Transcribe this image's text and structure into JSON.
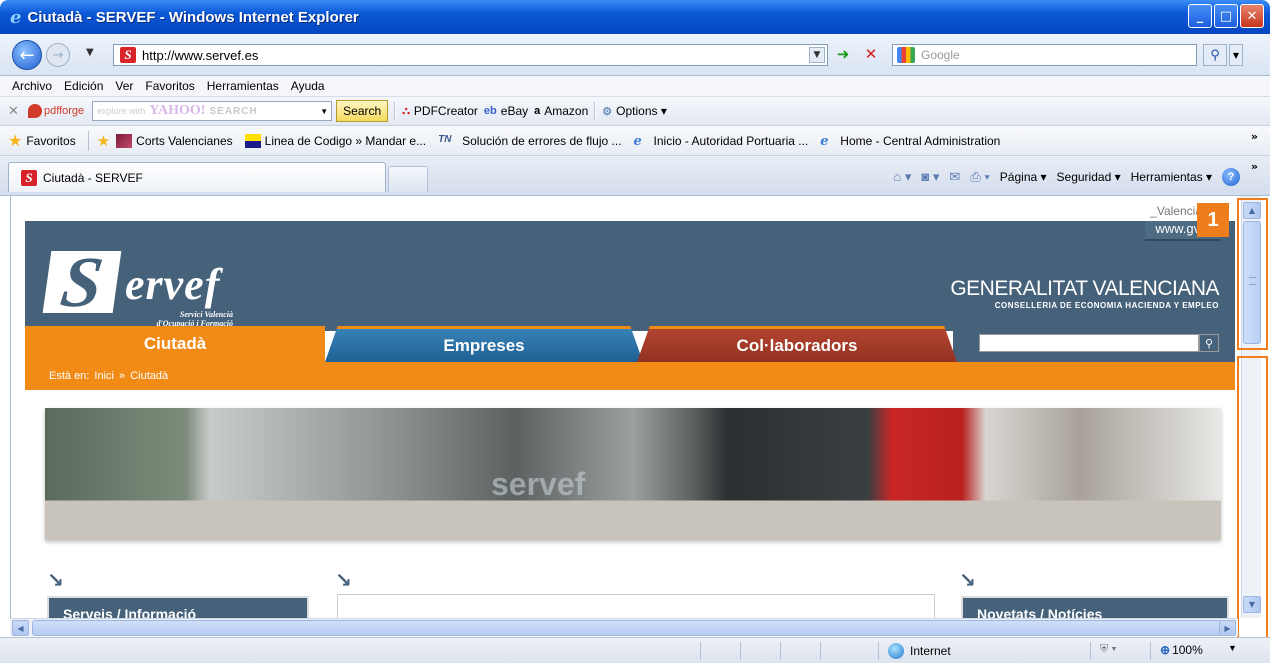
{
  "window": {
    "title": "Ciutadà - SERVEF - Windows Internet Explorer",
    "minimize": "_",
    "maximize": "□",
    "close": "✕"
  },
  "address_bar": {
    "url": "http://www.servef.es",
    "search_placeholder": "Google"
  },
  "menu": [
    "Archivo",
    "Edición",
    "Ver",
    "Favoritos",
    "Herramientas",
    "Ayuda"
  ],
  "toolbar": {
    "pdfforge": "pdfforge",
    "explore_text": "explore with",
    "yahoo": "YAHOO!",
    "yahoo_search": "SEARCH",
    "search_button": "Search",
    "pdfcreator": "PDFCreator",
    "ebay": "eBay",
    "amazon": "Amazon",
    "options": "Options ▾"
  },
  "favorites_bar": {
    "label": "Favoritos",
    "items": [
      "Corts Valencianes",
      "Linea de Codigo » Mandar e...",
      "Solución de errores de flujo ...",
      "Inicio - Autoridad Portuaria ...",
      "Home - Central Administration"
    ],
    "more": "»"
  },
  "tabs": {
    "active": "Ciutadà - SERVEF"
  },
  "command_bar": {
    "pagina": "Página ▾",
    "seguridad": "Seguridad ▾",
    "herramientas": "Herramientas ▾",
    "more": "»"
  },
  "site": {
    "lang_links": "_Valencià _Es",
    "gva_link": "www.gva.",
    "logo_letter": "S",
    "logo_rest": "ervef",
    "logo_sub1": "Servici Valencià",
    "logo_sub2": "d'Ocupació i Formació",
    "gva_line1": "GENERALITAT VALENCIANA",
    "gva_line2": "CONSELLERIA DE ECONOMIA HACIENDA Y EMPLEO",
    "nav": [
      "Ciutadà",
      "Empreses",
      "Col·laboradors"
    ],
    "breadcrumb_prefix": "Està en:",
    "breadcrumb_home": "Inici",
    "breadcrumb_sep": "»",
    "breadcrumb_current": "Ciutadà",
    "banner_sign": "servef",
    "box_left_title": "Serveis / Informació",
    "box_right_title": "Novetats / Notícies"
  },
  "annotation": {
    "callout": "1"
  },
  "status_bar": {
    "zone": "Internet",
    "zoom": "100%"
  }
}
